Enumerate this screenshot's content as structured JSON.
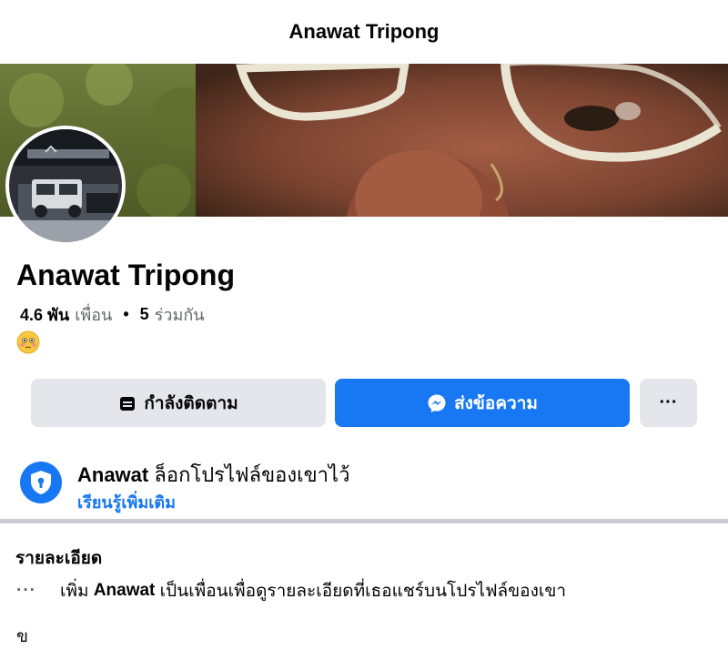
{
  "header": {
    "title": "Anawat Tripong"
  },
  "profile": {
    "name": "Anawat Tripong",
    "friends_count": "4.6 พัน",
    "friends_label": "เพื่อน",
    "mutual_count": "5",
    "mutual_label": "ร่วมกัน",
    "bio_emoji": "flushed-face-emoji"
  },
  "actions": {
    "follow_label": "กำลังติดตาม",
    "message_label": "ส่งข้อความ",
    "more_label": "···"
  },
  "lock_notice": {
    "name": "Anawat",
    "text": "ล็อกโปรไฟล์ของเขาไว้",
    "learn_more": "เรียนรู้เพิ่มเติม"
  },
  "details": {
    "title": "รายละเอียด",
    "row_prefix": "เพิ่ม",
    "row_name": "Anawat",
    "row_text": "เป็นเพื่อนเพื่อดูรายละเอียดที่เธอแชร์บนโปรไฟล์ของเขา",
    "cut_row_text": "ข"
  },
  "colors": {
    "accent": "#1877f2",
    "secondary_button": "#e4e6eb",
    "muted_text": "#65676b",
    "divider": "#c9ccd1"
  },
  "icons": {
    "follow": "person-check-icon",
    "message": "messenger-icon",
    "lock": "shield-lock-icon"
  }
}
